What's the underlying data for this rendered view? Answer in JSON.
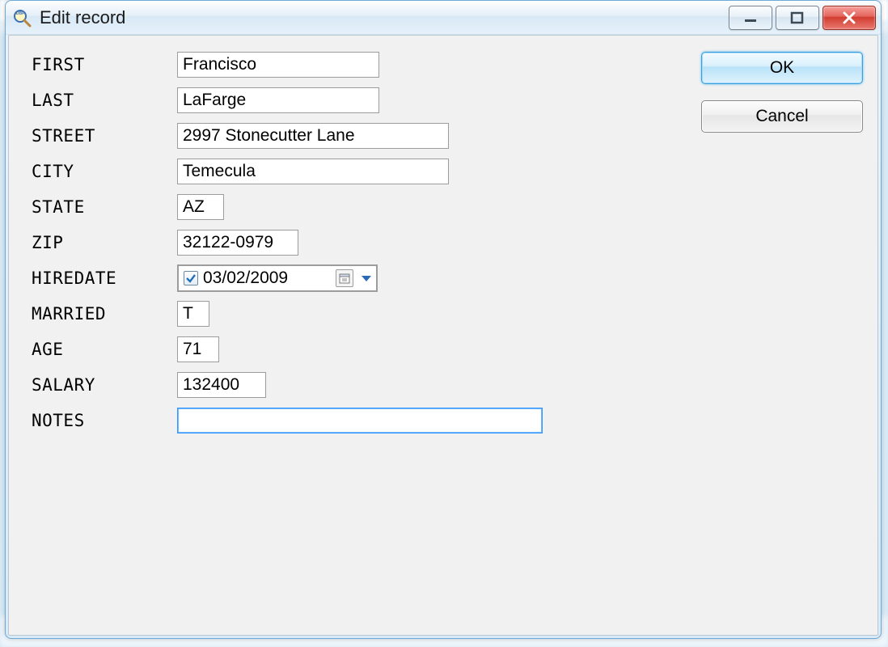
{
  "window": {
    "title": "Edit record"
  },
  "buttons": {
    "ok": "OK",
    "cancel": "Cancel"
  },
  "fields": {
    "first": {
      "label": "FIRST",
      "value": "Francisco"
    },
    "last": {
      "label": "LAST",
      "value": "LaFarge"
    },
    "street": {
      "label": "STREET",
      "value": "2997 Stonecutter Lane"
    },
    "city": {
      "label": "CITY",
      "value": "Temecula"
    },
    "state": {
      "label": "STATE",
      "value": "AZ"
    },
    "zip": {
      "label": "ZIP",
      "value": "32122-0979"
    },
    "hiredate": {
      "label": "HIREDATE",
      "value": "03/02/2009",
      "checked": true
    },
    "married": {
      "label": "MARRIED",
      "value": "T"
    },
    "age": {
      "label": "AGE",
      "value": "71"
    },
    "salary": {
      "label": "SALARY",
      "value": "132400"
    },
    "notes": {
      "label": "NOTES",
      "value": ""
    }
  }
}
